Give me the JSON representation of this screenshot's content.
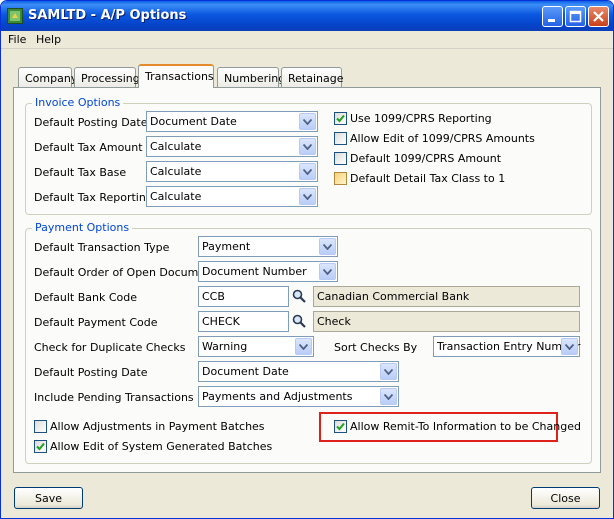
{
  "window": {
    "title": "SAMLTD - A/P Options"
  },
  "menu": {
    "file": "File",
    "help": "Help"
  },
  "tabs": {
    "company": "Company",
    "processing": "Processing",
    "transactions": "Transactions",
    "numbering": "Numbering",
    "retainage": "Retainage"
  },
  "invoice": {
    "legend": "Invoice Options",
    "posting_date": {
      "label": "Default Posting Date",
      "value": "Document Date"
    },
    "tax_amount": {
      "label": "Default Tax Amount",
      "value": "Calculate"
    },
    "tax_base": {
      "label": "Default Tax Base",
      "value": "Calculate"
    },
    "tax_reporting": {
      "label": "Default Tax Reporting",
      "value": "Calculate"
    },
    "use_1099": {
      "label": "Use 1099/CPRS Reporting",
      "checked": true
    },
    "allow_edit_1099": {
      "label": "Allow Edit of 1099/CPRS Amounts",
      "checked": false
    },
    "default_1099_amount": {
      "label": "Default 1099/CPRS Amount",
      "checked": false
    },
    "default_detail_tax": {
      "label": "Default Detail Tax Class to 1",
      "checked": false
    }
  },
  "payment": {
    "legend": "Payment Options",
    "transaction_type": {
      "label": "Default Transaction Type",
      "value": "Payment"
    },
    "order_open_docs": {
      "label": "Default Order of Open Documents",
      "value": "Document Number"
    },
    "bank_code": {
      "label": "Default Bank Code",
      "value": "CCB",
      "description": "Canadian Commercial Bank"
    },
    "payment_code": {
      "label": "Default Payment Code",
      "value": "CHECK",
      "description": "Check"
    },
    "duplicate_checks": {
      "label": "Check for Duplicate Checks",
      "value": "Warning"
    },
    "sort_checks": {
      "label": "Sort Checks By",
      "value": "Transaction Entry Number"
    },
    "posting_date": {
      "label": "Default Posting Date",
      "value": "Document Date"
    },
    "pending": {
      "label": "Include Pending Transactions",
      "value": "Payments and Adjustments"
    },
    "allow_adjustments": {
      "label": "Allow Adjustments in Payment Batches",
      "checked": false
    },
    "allow_edit_system": {
      "label": "Allow Edit of System Generated Batches",
      "checked": true
    },
    "allow_remit": {
      "label": "Allow Remit-To Information to be Changed",
      "checked": true
    }
  },
  "buttons": {
    "save": "Save",
    "close": "Close"
  },
  "colors": {
    "title_bar": "#0a5fe8",
    "legend": "#0046d5",
    "highlight": "#e0201a",
    "active_tab_accent": "#e68b2c"
  }
}
